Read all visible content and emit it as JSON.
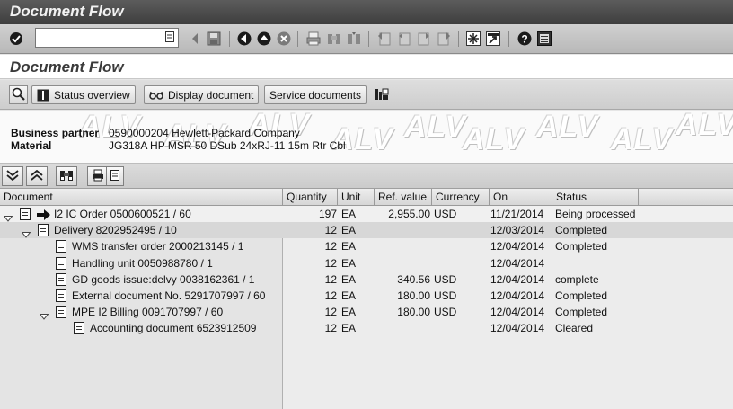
{
  "window": {
    "title": "Document Flow"
  },
  "system_toolbar": {
    "command_field": {
      "value": "",
      "placeholder": ""
    },
    "icons": [
      "enter-icon",
      "back-icon",
      "save-icon",
      "back-nav-icon",
      "exit-icon",
      "cancel-icon",
      "print-icon",
      "find-icon",
      "find-next-icon",
      "first-page-icon",
      "previous-page-icon",
      "next-page-icon",
      "last-page-icon",
      "create-session-icon",
      "shortcut-icon",
      "help-icon",
      "layout-menu-icon"
    ]
  },
  "screen": {
    "title": "Document Flow"
  },
  "app_toolbar": {
    "status_overview": "Status overview",
    "display_document": "Display document",
    "service_documents": "Service documents"
  },
  "header": {
    "business_partner": {
      "label": "Business partner",
      "value": "0590000204 Hewlett-Packard Company"
    },
    "material": {
      "label": "Material",
      "value": "JG318A HP MSR 50 DSub 24xRJ-11 15m Rtr Cbl"
    },
    "watermark": "ALV"
  },
  "table": {
    "columns": [
      "Document",
      "Quantity",
      "Unit",
      "Ref. value",
      "Currency",
      "On",
      "Status"
    ],
    "rows": [
      {
        "document": "I2 IC Order 0500600521 / 60",
        "quantity": "197",
        "unit": "EA",
        "ref_value": "2,955.00",
        "currency": "USD",
        "on": "11/21/2014",
        "status": "Being processed",
        "level": 0,
        "expander": "expanded",
        "current": true
      },
      {
        "document": "Delivery 8202952495 / 10",
        "quantity": "12",
        "unit": "EA",
        "ref_value": "",
        "currency": "",
        "on": "12/03/2014",
        "status": "Completed",
        "level": 1,
        "expander": "expanded",
        "current": false
      },
      {
        "document": "WMS transfer order 2000213145 / 1",
        "quantity": "12",
        "unit": "EA",
        "ref_value": "",
        "currency": "",
        "on": "12/04/2014",
        "status": "Completed",
        "level": 2,
        "expander": "none",
        "current": false
      },
      {
        "document": "Handling unit 0050988780 / 1",
        "quantity": "12",
        "unit": "EA",
        "ref_value": "",
        "currency": "",
        "on": "12/04/2014",
        "status": "",
        "level": 2,
        "expander": "none",
        "current": false
      },
      {
        "document": "GD goods issue:delvy 0038162361 / 1",
        "quantity": "12",
        "unit": "EA",
        "ref_value": "340.56",
        "currency": "USD",
        "on": "12/04/2014",
        "status": "complete",
        "level": 2,
        "expander": "none",
        "current": false
      },
      {
        "document": "External document No. 5291707997 / 60",
        "quantity": "12",
        "unit": "EA",
        "ref_value": "180.00",
        "currency": "USD",
        "on": "12/04/2014",
        "status": "Completed",
        "level": 2,
        "expander": "none",
        "current": false
      },
      {
        "document": "MPE I2 Billing 0091707997 / 60",
        "quantity": "12",
        "unit": "EA",
        "ref_value": "180.00",
        "currency": "USD",
        "on": "12/04/2014",
        "status": "Completed",
        "level": 2,
        "expander": "expanded",
        "current": false
      },
      {
        "document": "Accounting document 6523912509",
        "quantity": "12",
        "unit": "EA",
        "ref_value": "",
        "currency": "",
        "on": "12/04/2014",
        "status": "Cleared",
        "level": 3,
        "expander": "none",
        "current": false
      }
    ]
  }
}
